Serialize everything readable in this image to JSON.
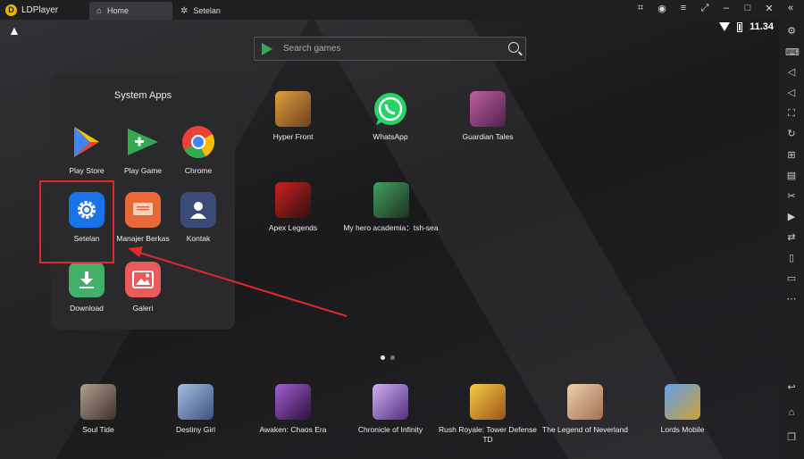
{
  "titlebar": {
    "app_name": "LDPlayer",
    "tabs": [
      {
        "label": "Home",
        "icon": "home-icon",
        "active": true
      },
      {
        "label": "Setelan",
        "icon": "gear-icon",
        "active": false
      }
    ]
  },
  "status": {
    "time": "11.34"
  },
  "search": {
    "placeholder": "Search games"
  },
  "folder": {
    "title": "System Apps",
    "apps": [
      {
        "label": "Play Store",
        "icon": "play-store-icon",
        "color": "#ffffff"
      },
      {
        "label": "Play Game",
        "icon": "play-games-icon",
        "color": "#34a853"
      },
      {
        "label": "Chrome",
        "icon": "chrome-icon",
        "color": "#ffffff"
      },
      {
        "label": "Setelan",
        "icon": "settings-gear-icon",
        "color": "#1a73e8",
        "highlighted": true
      },
      {
        "label": "Manajer Berkas",
        "icon": "file-manager-icon",
        "color": "#e8683a"
      },
      {
        "label": "Kontak",
        "icon": "contacts-icon",
        "color": "#3b4a78"
      },
      {
        "label": "Download",
        "icon": "download-icon",
        "color": "#43b06a"
      },
      {
        "label": "Galeri",
        "icon": "gallery-icon",
        "color": "#ec5b5b"
      }
    ]
  },
  "desktop": {
    "apps": [
      {
        "label": "Hyper Front",
        "color": "#c98d3a"
      },
      {
        "label": "WhatsApp",
        "color": "#25d366"
      },
      {
        "label": "Guardian Tales",
        "color": "#8a3b7a"
      },
      {
        "label": "Apex Legends",
        "color": "#b02020"
      },
      {
        "label": "My hero academia：tsh-sea",
        "color": "#3a6a3a"
      }
    ],
    "page_indicator": {
      "pages": 2,
      "current": 1
    }
  },
  "dock": {
    "apps": [
      {
        "label": "Soul Tide",
        "color": "#6b5a55"
      },
      {
        "label": "Destiny Girl",
        "color": "#7a90c0"
      },
      {
        "label": "Awaken: Chaos Era",
        "color": "#6a3a8a"
      },
      {
        "label": "Chronicle of Infinity",
        "color": "#9a7ac0"
      },
      {
        "label": "Rush Royale: Tower Defense TD",
        "color": "#d8a030"
      },
      {
        "label": "The Legend of Neverland",
        "color": "#e0b090"
      },
      {
        "label": "Lords Mobile",
        "color": "#3a7ad0"
      }
    ]
  },
  "colors": {
    "highlight": "#e0292b",
    "background": "#1b1b1d"
  }
}
